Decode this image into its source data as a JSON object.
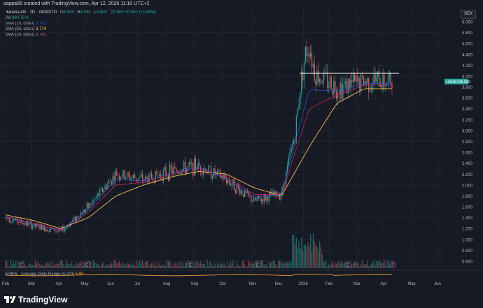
{
  "header": {
    "attribution": "zappa66 created with TradingView.com, Apr 12, 2026 11:10 UTC+2"
  },
  "legend": {
    "symbol": "Hanexa AB · 1D · OMXSTO",
    "o_label": "O",
    "o": "3.805",
    "h_label": "H",
    "h": "4.050",
    "l_label": "L",
    "l": "3.805",
    "c_label": "C",
    "c": "3.900",
    "change": "+0.065 (+1.69%)",
    "vol_label": "Vol",
    "vol": "890.78 K",
    "sma10_label": "SMA (10, close)",
    "sma10": "3.761",
    "sma50_label": "SMA (50, close)",
    "sma50": "3.774",
    "sma20_label": "SMA (20, close)",
    "sma20": "3.761"
  },
  "currency": "SEK",
  "price_axis": [
    "5.000",
    "4.800",
    "4.600",
    "4.400",
    "4.200",
    "4.000",
    "3.800",
    "3.600",
    "3.400",
    "3.200",
    "3.000",
    "2.800",
    "2.600",
    "2.400",
    "2.200",
    "2.000",
    "1.800",
    "1.600",
    "1.400",
    "1.200",
    "1.000",
    "0.800",
    "0.600"
  ],
  "price_tag": {
    "symbol": "HANEXA",
    "price": "3.900"
  },
  "time_axis": [
    "Feb",
    "Mar",
    "Apr",
    "May",
    "Jun",
    "Jul",
    "Aug",
    "Sep",
    "Oct",
    "Nov",
    "Dec",
    "2026",
    "Feb",
    "Mar",
    "Apr",
    "May",
    "Jun"
  ],
  "event_markers": {
    "earnings": "E",
    "dividend": "E",
    "split": "F"
  },
  "adr": {
    "label": "ADR% · Average Daily Range % (20)",
    "value": "5.95"
  },
  "footer": {
    "brand": "TradingView"
  },
  "colors": {
    "bg": "#161a25",
    "up": "#26a69a",
    "down": "#ef5350",
    "sma10": "#2962ff",
    "sma20": "#e91e63",
    "sma50": "#ffb74d",
    "resistance": "#ffffff"
  },
  "chart_data": {
    "type": "candlestick",
    "ylim": [
      0.5,
      5.1
    ],
    "resistance_level": 4.05,
    "last_close": 3.9,
    "x": [
      "2025-02",
      "2025-03",
      "2025-04",
      "2025-05",
      "2025-06",
      "2025-07",
      "2025-08",
      "2025-09",
      "2025-10",
      "2025-11",
      "2025-12",
      "2026-01",
      "2026-02",
      "2026-03",
      "2026-04"
    ],
    "series": [
      {
        "name": "Close",
        "values": [
          1.4,
          1.25,
          1.15,
          1.6,
          2.2,
          2.1,
          2.25,
          2.35,
          2.1,
          1.7,
          1.85,
          4.1,
          3.8,
          3.9,
          3.9
        ]
      },
      {
        "name": "SMA (50, close)",
        "values": [
          1.45,
          1.35,
          1.2,
          1.4,
          1.8,
          2.0,
          2.15,
          2.25,
          2.2,
          1.95,
          1.8,
          2.7,
          3.5,
          3.77,
          3.77
        ]
      }
    ]
  }
}
